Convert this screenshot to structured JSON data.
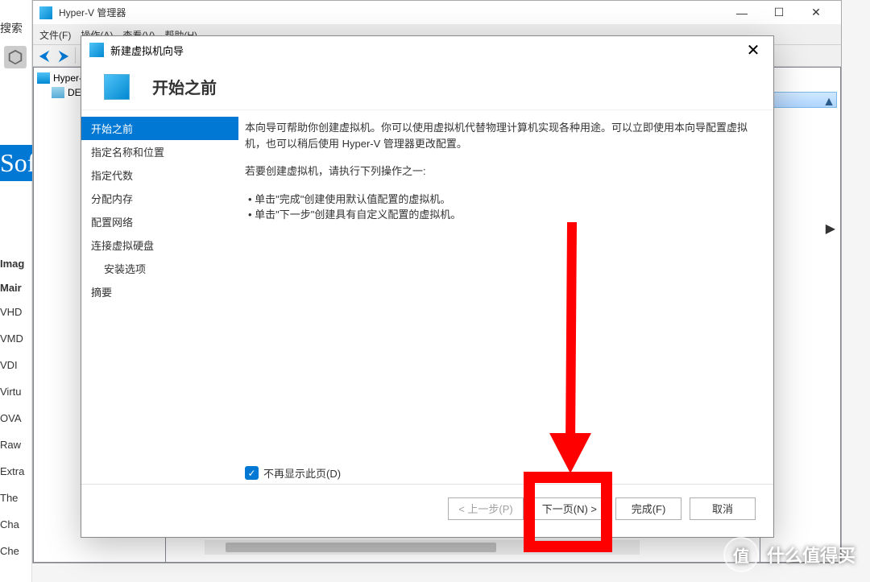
{
  "left_partial": {
    "search": "搜索",
    "soft": "Sof",
    "imag": "Imag",
    "main": "Mair",
    "items": [
      "VHD",
      "VMD",
      "VDI",
      "Virtu",
      "OVA",
      "Raw",
      "Extra",
      "The",
      "Cha",
      "Che"
    ]
  },
  "hv": {
    "title": "Hyper-V 管理器",
    "menu": {
      "file": "文件(F)",
      "action": "操作(A)",
      "view": "查看(V)",
      "help": "帮助(H)"
    },
    "tree": {
      "root": "Hyper-",
      "child": "DES"
    }
  },
  "wizard": {
    "title": "新建虚拟机向导",
    "heading": "开始之前",
    "steps": {
      "s0": "开始之前",
      "s1": "指定名称和位置",
      "s2": "指定代数",
      "s3": "分配内存",
      "s4": "配置网络",
      "s5": "连接虚拟硬盘",
      "s6": "安装选项",
      "s7": "摘要"
    },
    "intro": "本向导可帮助你创建虚拟机。你可以使用虚拟机代替物理计算机实现各种用途。可以立即使用本向导配置虚拟机，也可以稍后使用 Hyper-V 管理器更改配置。",
    "prompt": "若要创建虚拟机，请执行下列操作之一:",
    "bullet1": "单击\"完成\"创建使用默认值配置的虚拟机。",
    "bullet2": "单击\"下一步\"创建具有自定义配置的虚拟机。",
    "checkbox": "不再显示此页(D)",
    "btn_prev": "< 上一步(P)",
    "btn_next": "下一页(N) >",
    "btn_finish": "完成(F)",
    "btn_cancel": "取消"
  },
  "watermark": {
    "zhi": "值",
    "text": "什么值得买"
  },
  "icons": {
    "close": "✕",
    "min": "—",
    "max": "☐",
    "arrow_l": "⮜",
    "arrow_r": "⮞",
    "check": "✓",
    "tri_up": "▲",
    "tri_r": "▶"
  }
}
